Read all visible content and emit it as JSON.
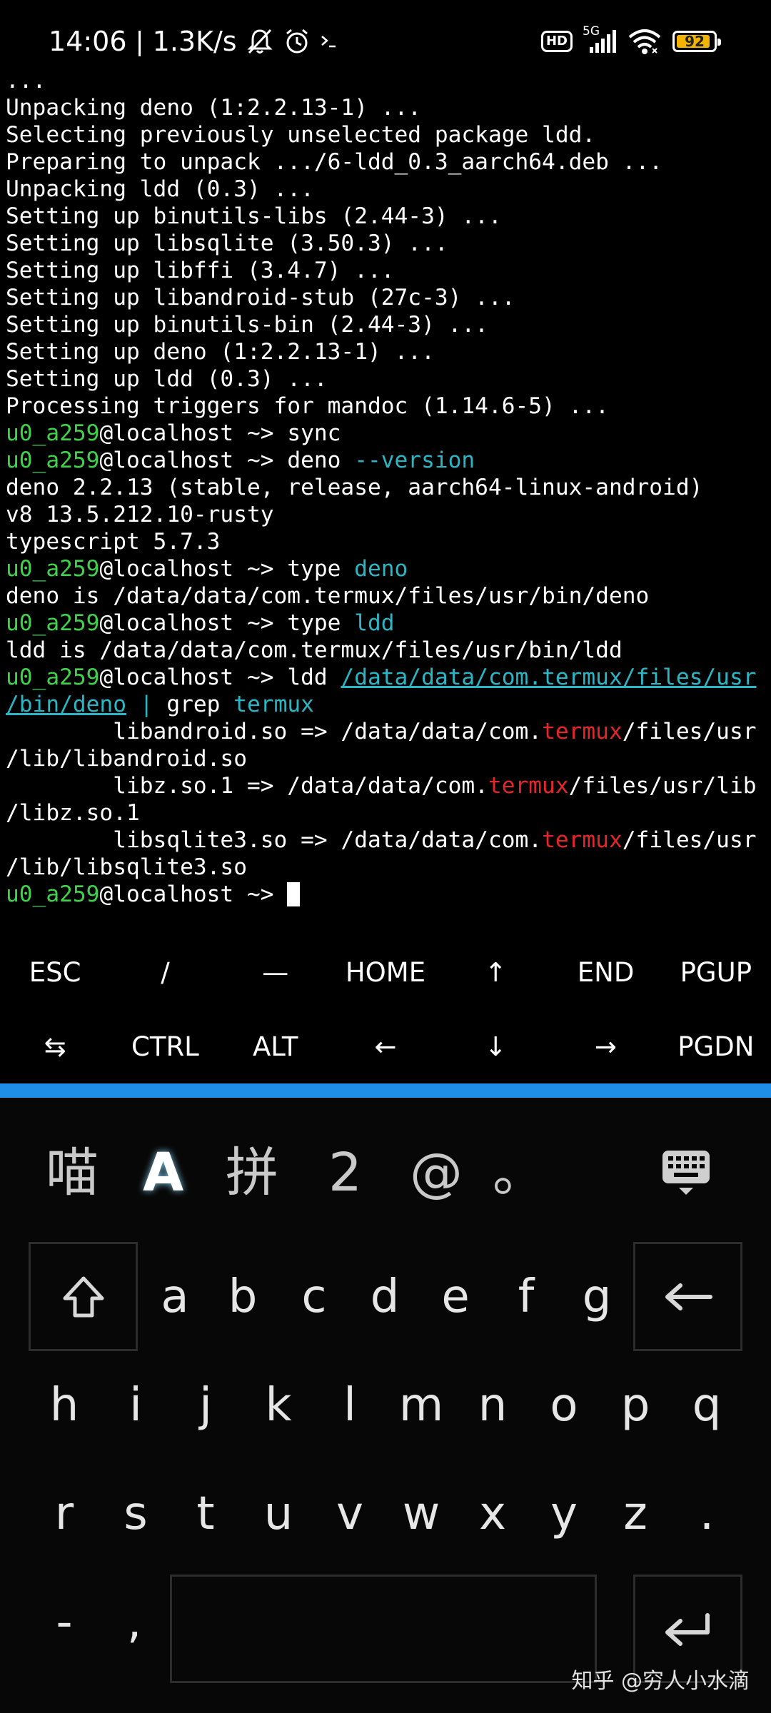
{
  "status_bar": {
    "time": "14:06",
    "net_speed": "1.3K/s",
    "hd": "HD",
    "network": "5G",
    "battery": "92",
    "battery_level": 0.92,
    "icons": [
      "mute-bell-icon",
      "alarm-icon",
      "terminal-prompt-icon",
      "signal-icon",
      "wifi-icon",
      "battery-icon"
    ]
  },
  "terminal": {
    "prompt": "u0_a259",
    "host_prompt": "@localhost ~> ",
    "lines": {
      "l0": "...",
      "l1": "Unpacking deno (1:2.2.13-1) ...",
      "l2": "Selecting previously unselected package ldd.",
      "l3": "Preparing to unpack .../6-ldd_0.3_aarch64.deb ...",
      "l4": "Unpacking ldd (0.3) ...",
      "l5": "Setting up binutils-libs (2.44-3) ...",
      "l6": "Setting up libsqlite (3.50.3) ...",
      "l7": "Setting up libffi (3.4.7) ...",
      "l8": "Setting up libandroid-stub (27c-3) ...",
      "l9": "Setting up binutils-bin (2.44-3) ...",
      "l10": "Setting up deno (1:2.2.13-1) ...",
      "l11": "Setting up ldd (0.3) ...",
      "l12": "Processing triggers for mandoc (1.14.6-5) ...",
      "l13_cmd": "sync",
      "l14_cmd": "deno ",
      "l14_arg": "--version",
      "l15": "deno 2.2.13 (stable, release, aarch64-linux-android)",
      "l16": "v8 13.5.212.10-rusty",
      "l17": "typescript 5.7.3",
      "l18_cmd": "type ",
      "l18_arg": "deno",
      "l19": "deno is /data/data/com.termux/files/usr/bin/deno",
      "l20_cmd": "type ",
      "l20_arg": "ldd",
      "l21": "ldd is /data/data/com.termux/files/usr/bin/ldd",
      "l22_cmd": "ldd ",
      "l22_link": "/data/data/com.termux/files/usr",
      "l23_link": "/bin/deno",
      "l23_pipe": " | ",
      "l23_grep": "grep ",
      "l23_arg": "termux",
      "l24_a": "        libandroid.so => /data/data/com.",
      "l24_b": "termux",
      "l24_c": "/files/usr",
      "l25": "/lib/libandroid.so",
      "l26_a": "        libz.so.1 => /data/data/com.",
      "l26_b": "termux",
      "l26_c": "/files/usr/lib",
      "l27": "/libz.so.1",
      "l28_a": "        libsqlite3.so => /data/data/com.",
      "l28_b": "termux",
      "l28_c": "/files/usr",
      "l29": "/lib/libsqlite3.so"
    }
  },
  "extra_keys": {
    "row1": [
      "ESC",
      "/",
      "—",
      "HOME",
      "↑",
      "END",
      "PGUP"
    ],
    "row2": [
      "⇆",
      "CTRL",
      "ALT",
      "←",
      "↓",
      "→",
      "PGDN"
    ]
  },
  "keyboard": {
    "candidates": [
      "喵",
      "A",
      "拼",
      "2",
      "@",
      "。"
    ],
    "row1": [
      "a",
      "b",
      "c",
      "d",
      "e",
      "f",
      "g"
    ],
    "row2": [
      "h",
      "i",
      "j",
      "k",
      "l",
      "m",
      "n",
      "o",
      "p",
      "q"
    ],
    "row3": [
      "r",
      "s",
      "t",
      "u",
      "v",
      "w",
      "x",
      "y",
      "z",
      "."
    ],
    "row4": [
      "-",
      ","
    ]
  },
  "watermark": "知乎 @穷人小水滴",
  "colors": {
    "prompt_green": "#3fd24a",
    "cyan": "#2bb6c6",
    "red": "#e3262a",
    "divider_blue": "#1f8ee8",
    "battery_yellow": "#f2b400"
  }
}
